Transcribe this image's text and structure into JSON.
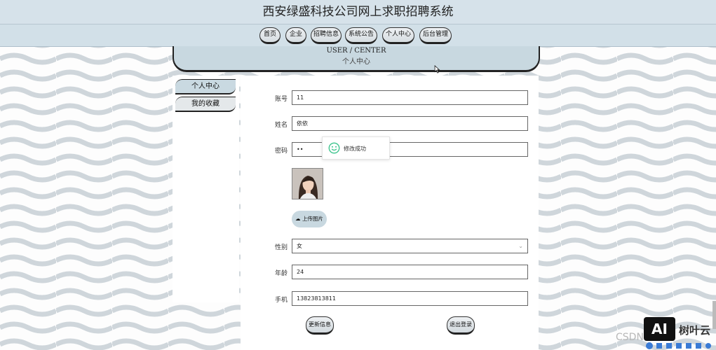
{
  "header": {
    "title": "西安绿盛科技公司网上求职招聘系统"
  },
  "nav": {
    "items": [
      "首页",
      "企业",
      "招聘信息",
      "系统公告",
      "个人中心",
      "后台管理"
    ]
  },
  "banner": {
    "title_en": "USER / CENTER",
    "title_cn": "个人中心"
  },
  "sidebar": {
    "items": [
      {
        "label": "个人中心",
        "active": true
      },
      {
        "label": "我的收藏",
        "active": false
      }
    ]
  },
  "form": {
    "account": {
      "label": "账号",
      "value": "11"
    },
    "name": {
      "label": "姓名",
      "value": "依依"
    },
    "password": {
      "label": "密码",
      "value": "••"
    },
    "upload_label": "上传图片",
    "gender": {
      "label": "性别",
      "value": "女"
    },
    "age": {
      "label": "年龄",
      "value": "24"
    },
    "phone": {
      "label": "手机",
      "value": "13823813811"
    },
    "update_button": "更新信息",
    "logout_button": "退出登录"
  },
  "toast": {
    "message": "修改成功",
    "icon": "smile-icon"
  },
  "watermark": {
    "text": "CSDN",
    "logo": "AI",
    "brand": "树叶云"
  },
  "colors": {
    "accent": "#c8d8e0",
    "nav_bg": "#d2e0e8",
    "toast_icon": "#3cc48d"
  }
}
